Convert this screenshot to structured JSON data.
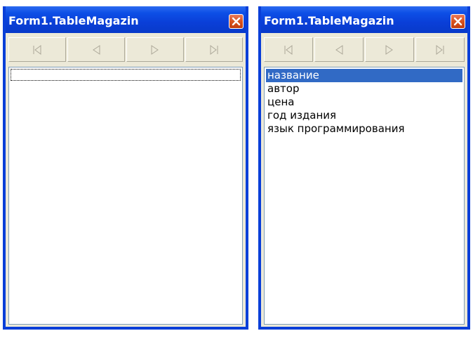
{
  "windows": [
    {
      "title": "Form1.TableMagazin",
      "list_items": []
    },
    {
      "title": "Form1.TableMagazin",
      "list_items": [
        "название",
        "автор",
        "цена",
        "год издания",
        "язык программирования"
      ],
      "selected_index": 0
    }
  ],
  "navigator_buttons": [
    "first-icon",
    "prior-icon",
    "next-icon",
    "last-icon"
  ],
  "colors": {
    "title_bar": "#0a3fd8",
    "close_button": "#d9531e",
    "face": "#ece9d8",
    "selection": "#316ac5",
    "disabled_glyph": "#aca899"
  }
}
